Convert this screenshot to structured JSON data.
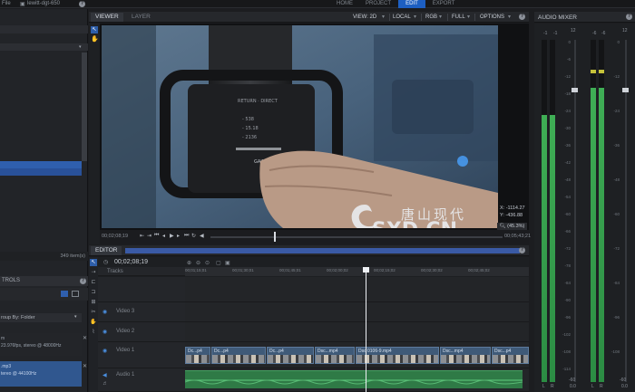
{
  "topbar": {
    "menu_file": "File",
    "project_name": "lewitt-dgt-650",
    "modes": [
      {
        "label": "HOME",
        "active": false
      },
      {
        "label": "PROJECT",
        "active": false
      },
      {
        "label": "EDIT",
        "active": true
      },
      {
        "label": "EXPORT",
        "active": false
      }
    ]
  },
  "left_panel": {
    "item_count": "349 item(s)",
    "controls_header": "TROLS",
    "group_by": "roup By: Folder",
    "media_items": [
      {
        "line1": "m",
        "line2": "23.976fps, stereo @ 48000Hz"
      },
      {
        "line1": ".mp3",
        "line2": "tereo @ 44100Hz"
      }
    ]
  },
  "viewer": {
    "tabs": [
      {
        "label": "VIEWER",
        "active": true
      },
      {
        "label": "LAYER",
        "active": false
      }
    ],
    "options": {
      "view": "VIEW: 2D",
      "space": "LOCAL",
      "color": "RGB",
      "res": "FULL",
      "menu": "OPTIONS"
    },
    "timecode_in": "00;02;08;19",
    "timecode_out": "00;05;43;21",
    "coord_x": "X: -1114.27",
    "coord_y": "Y: -436.88",
    "zoom": "(45.3%)"
  },
  "watermark": {
    "cn": "唐山现代",
    "en": "SXD.CN"
  },
  "editor": {
    "title": "EDITOR",
    "timecode": "00;02;08;19",
    "tracks_label": "Tracks",
    "ruler": [
      "00;01;15;01",
      "00;01;30;01",
      "00;01;45;01",
      "00;02;00;02",
      "00;02;15;02",
      "00;02;30;02",
      "00;02;45;02"
    ],
    "tracks": [
      {
        "name": "Video 3",
        "type": "video"
      },
      {
        "name": "Video 2",
        "type": "video"
      },
      {
        "name": "Video 1",
        "type": "video"
      },
      {
        "name": "Audio 1",
        "type": "audio"
      }
    ],
    "clips": [
      "Dc...p4",
      "Dc...p4",
      "Dc...p4",
      "Dsc...mp4",
      "Dsc 0106-9.mp4",
      "Dsc...mp4",
      "Dsc...p4"
    ]
  },
  "mixer": {
    "title": "AUDIO MIXER",
    "scale": [
      "0",
      "-6",
      "-12",
      "-18",
      "-24",
      "-30",
      "-36",
      "-42",
      "-48",
      "-54",
      "-60",
      "-66",
      "-72",
      "-78",
      "-84",
      "-90",
      "-96",
      "-102",
      "-108",
      "-114"
    ],
    "top_marks": [
      "-1",
      "-1",
      "12",
      "-6",
      "-6",
      "12"
    ],
    "channels": [
      {
        "left": "L",
        "right": "R",
        "level": 0.78,
        "value": "0.0"
      },
      {
        "left": "L",
        "right": "R",
        "level": 0.86,
        "value": "0.0"
      }
    ],
    "bottom_left": "-60",
    "bottom_right": "-60",
    "accent_color": "#1d5fc2",
    "meter_color": "#3fae55"
  }
}
